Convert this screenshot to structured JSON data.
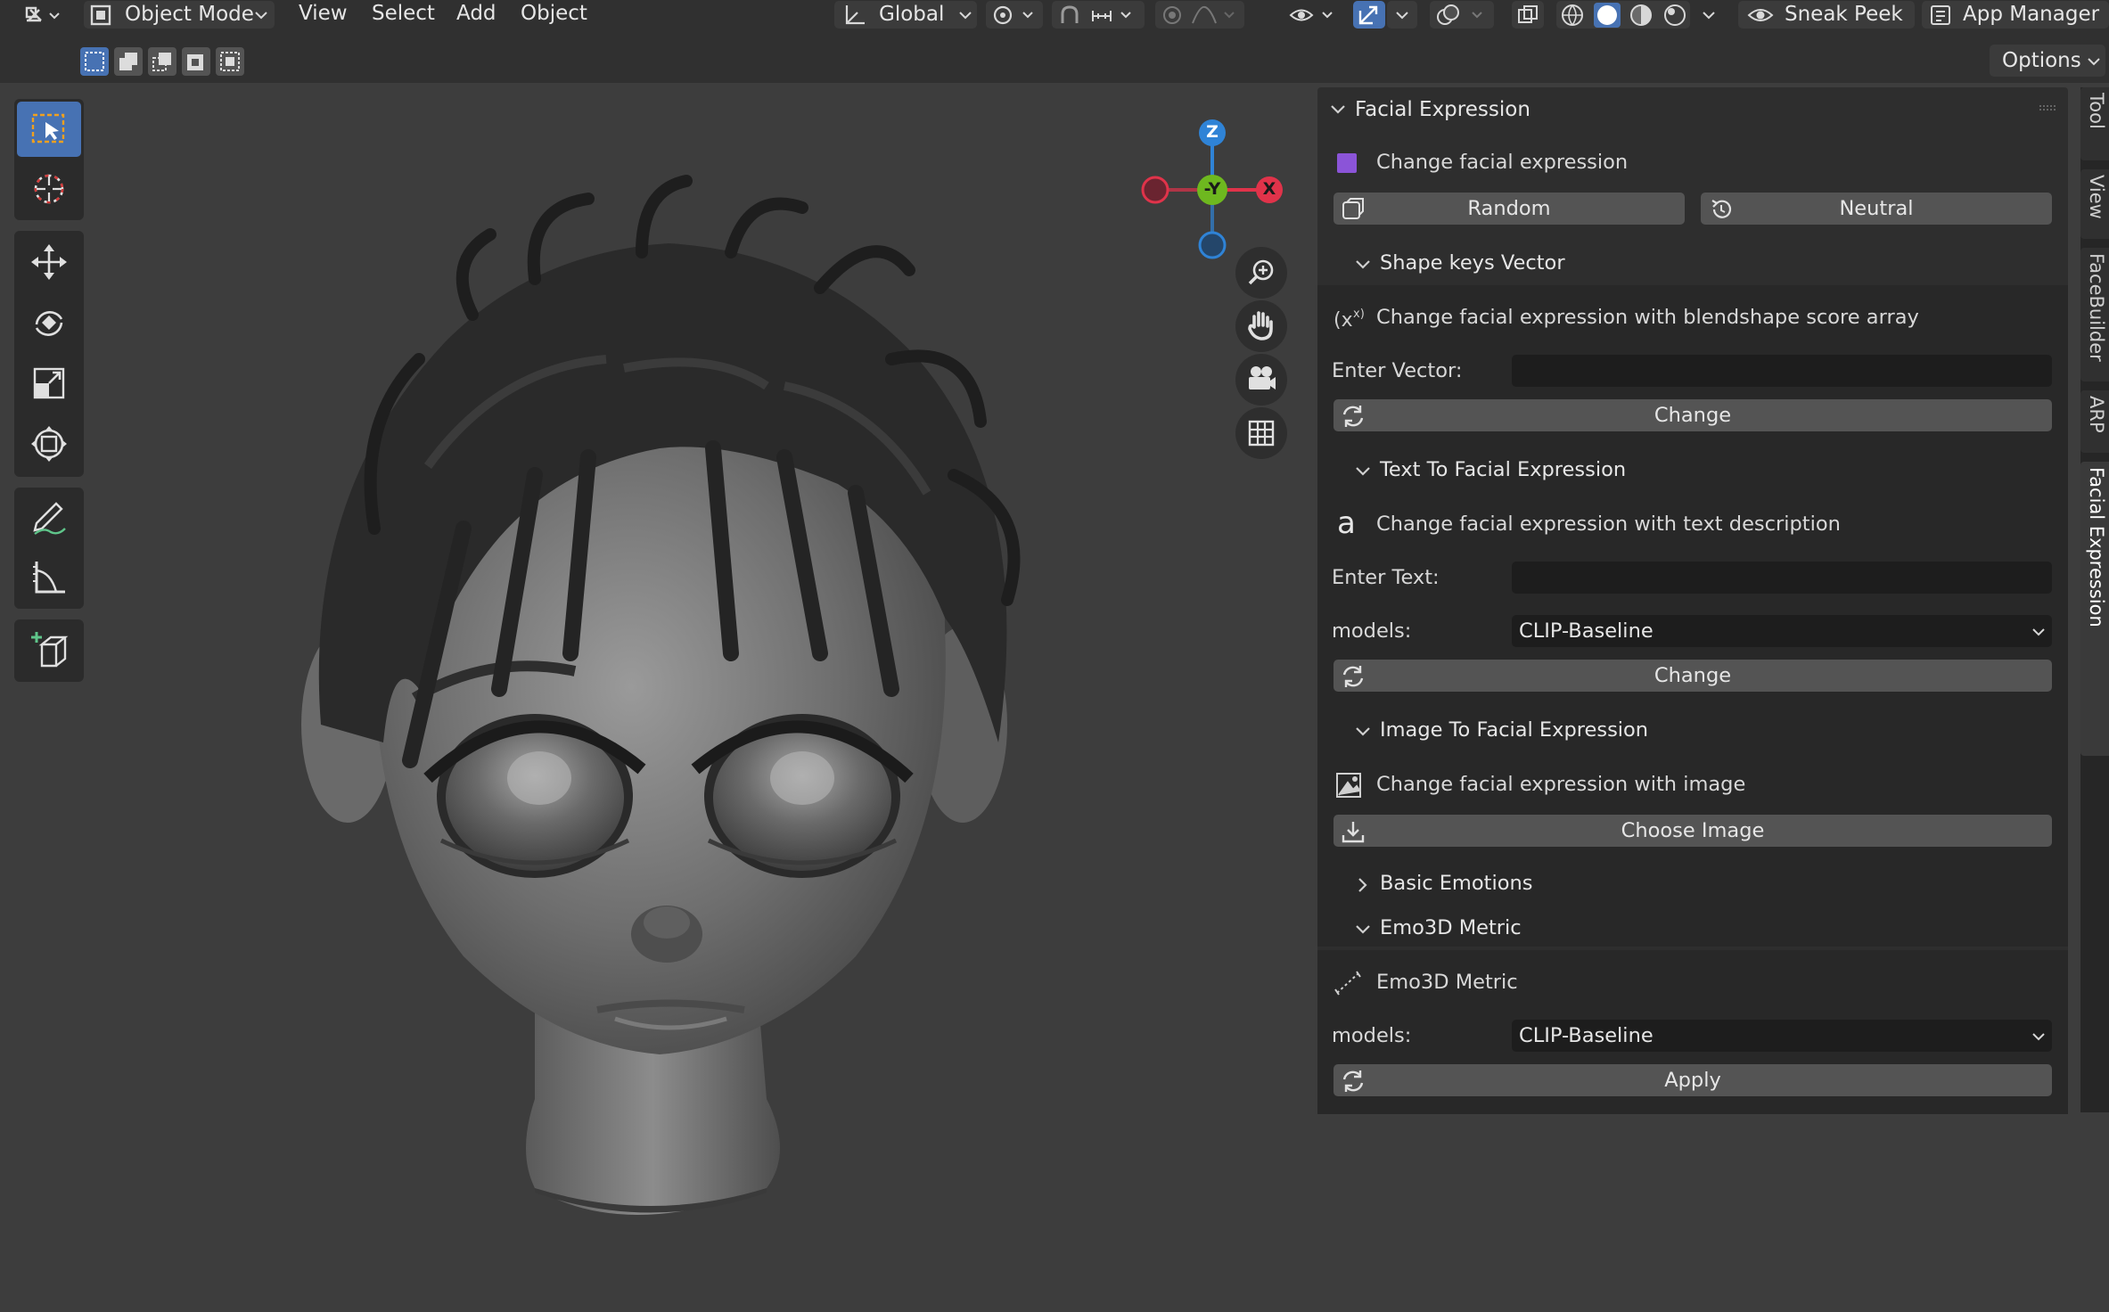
{
  "header": {
    "mode_label": "Object Mode",
    "menus": [
      "View",
      "Select",
      "Add",
      "Object"
    ],
    "orientation_label": "Global",
    "sneak_peek_label": "Sneak Peek",
    "app_manager_label": "App Manager"
  },
  "subheader": {
    "options_label": "Options"
  },
  "gizmo": {
    "z_label": "Z",
    "y_label": "-Y",
    "x_label": "X",
    "colors": {
      "z": "#2f83d6",
      "y": "#6eb81f",
      "x": "#e0334a"
    }
  },
  "panel": {
    "title": "Facial Expression",
    "change_label": "Change facial expression",
    "random_label": "Random",
    "neutral_label": "Neutral",
    "shape_keys": {
      "title": "Shape keys Vector",
      "desc": "Change facial expression with blendshape score array",
      "input_label": "Enter Vector:",
      "input_value": "",
      "button_label": "Change"
    },
    "text_expr": {
      "title": "Text To Facial Expression",
      "desc": "Change facial expression with text description",
      "input_label": "Enter Text:",
      "input_value": "",
      "models_label": "models:",
      "models_value": "CLIP-Baseline",
      "button_label": "Change"
    },
    "image_expr": {
      "title": "Image To Facial Expression",
      "desc": "Change facial expression with image",
      "button_label": "Choose Image"
    },
    "basic_emotions": {
      "title": "Basic Emotions"
    },
    "emo3d": {
      "title": "Emo3D Metric",
      "desc": "Emo3D Metric",
      "models_label": "models:",
      "models_value": "CLIP-Baseline",
      "button_label": "Apply"
    }
  },
  "tabs": [
    "Tool",
    "View",
    "FaceBuilder",
    "ARP",
    "Facial Expression"
  ],
  "colors": {
    "accent": "#4772b3",
    "panel": "#2e2e2e",
    "swatch": "#8b54d8"
  },
  "icons": [
    "editor-type-icon",
    "object-mode-icon",
    "orientation-icon",
    "snap-icon",
    "proportional-icon",
    "overlay-icon",
    "gizmo-icon",
    "xray-icon",
    "shading-icon",
    "sneak-peek-icon",
    "app-manager-icon",
    "select-box-icon",
    "cursor-icon",
    "move-icon",
    "rotate-icon",
    "scale-icon",
    "transform-icon",
    "annotate-icon",
    "measure-icon",
    "add-cube-icon",
    "zoom-icon",
    "pan-hand-icon",
    "camera-icon",
    "grid-icon",
    "refresh-icon",
    "image-icon",
    "text-icon",
    "vector-icon",
    "metric-icon"
  ]
}
